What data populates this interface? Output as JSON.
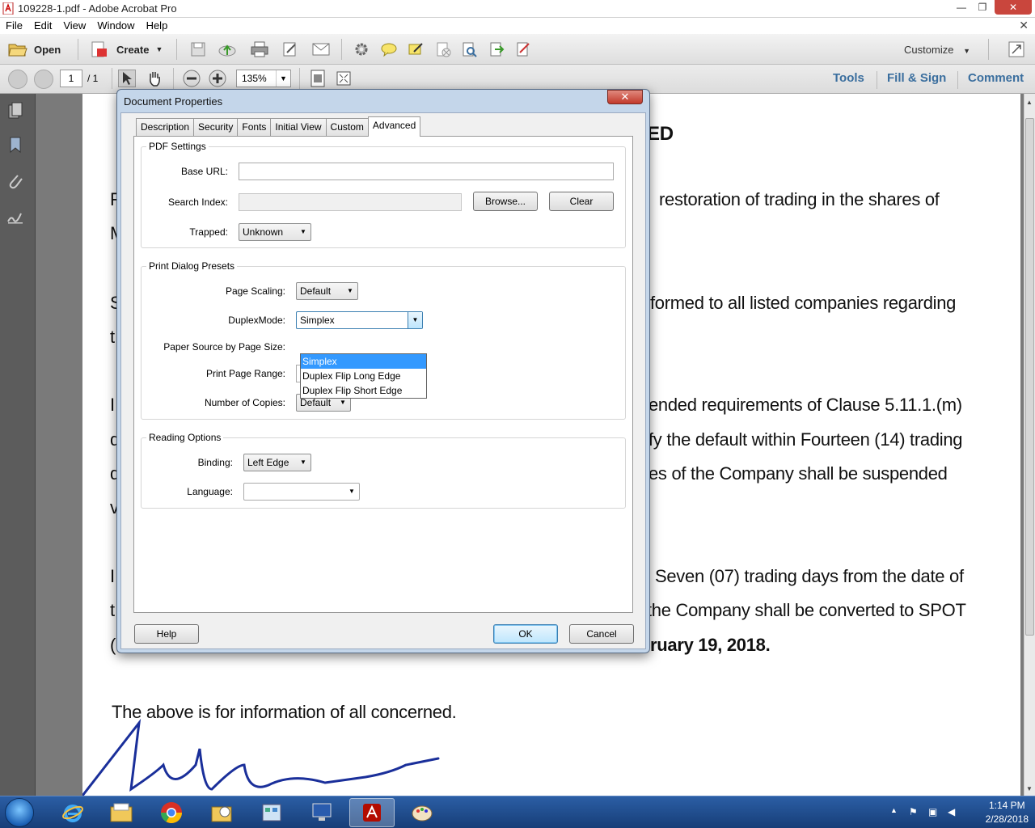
{
  "window": {
    "title": "109228-1.pdf - Adobe Acrobat Pro",
    "controls": {
      "minimize": "—",
      "maximize": "❐",
      "close": "✕"
    }
  },
  "menubar": {
    "items": [
      "File",
      "Edit",
      "View",
      "Window",
      "Help"
    ],
    "close_doc": "✕"
  },
  "toolbar": {
    "open_label": "Open",
    "create_label": "Create",
    "customize_label": "Customize"
  },
  "navbar": {
    "page_current": "1",
    "page_total": "/ 1",
    "zoom": "135%",
    "tools_label": "Tools",
    "fill_sign_label": "Fill & Sign",
    "comment_label": "Comment"
  },
  "document": {
    "lines": [
      "ED",
      "restoration of trading in the shares of",
      "formed to all listed companies regarding",
      "ended requirements of Clause 5.11.1.(m)",
      "fy the default within Fourteen (14) trading",
      "es of the Company  shall be suspended",
      "Seven (07) trading days from the date of",
      "the Company shall be converted to SPOT",
      "ruary 19, 2018.",
      "The above is for information of all concerned."
    ],
    "left_fragments": [
      "F",
      "M",
      "S",
      "t",
      "I",
      "d",
      "d",
      "v",
      "I",
      "t",
      "("
    ]
  },
  "dialog": {
    "title": "Document Properties",
    "close": "✕",
    "tabs": [
      "Description",
      "Security",
      "Fonts",
      "Initial View",
      "Custom",
      "Advanced"
    ],
    "active_tab": "Advanced",
    "pdf_settings": {
      "legend": "PDF Settings",
      "base_url_label": "Base URL:",
      "base_url_value": "",
      "search_index_label": "Search Index:",
      "search_index_value": "",
      "browse_label": "Browse...",
      "clear_label": "Clear",
      "trapped_label": "Trapped:",
      "trapped_value": "Unknown"
    },
    "print_presets": {
      "legend": "Print Dialog Presets",
      "page_scaling_label": "Page Scaling:",
      "page_scaling_value": "Default",
      "duplex_label": "DuplexMode:",
      "duplex_value": "Simplex",
      "duplex_options": [
        "Simplex",
        "Duplex Flip Long Edge",
        "Duplex Flip Short Edge"
      ],
      "paper_source_label": "Paper Source by Page Size:",
      "print_range_label": "Print Page Range:",
      "copies_label": "Number of Copies:",
      "copies_value": "Default"
    },
    "reading_options": {
      "legend": "Reading Options",
      "binding_label": "Binding:",
      "binding_value": "Left Edge",
      "language_label": "Language:",
      "language_value": ""
    },
    "help_label": "Help",
    "ok_label": "OK",
    "cancel_label": "Cancel"
  },
  "taskbar": {
    "time": "1:14 PM",
    "date": "2/28/2018"
  }
}
